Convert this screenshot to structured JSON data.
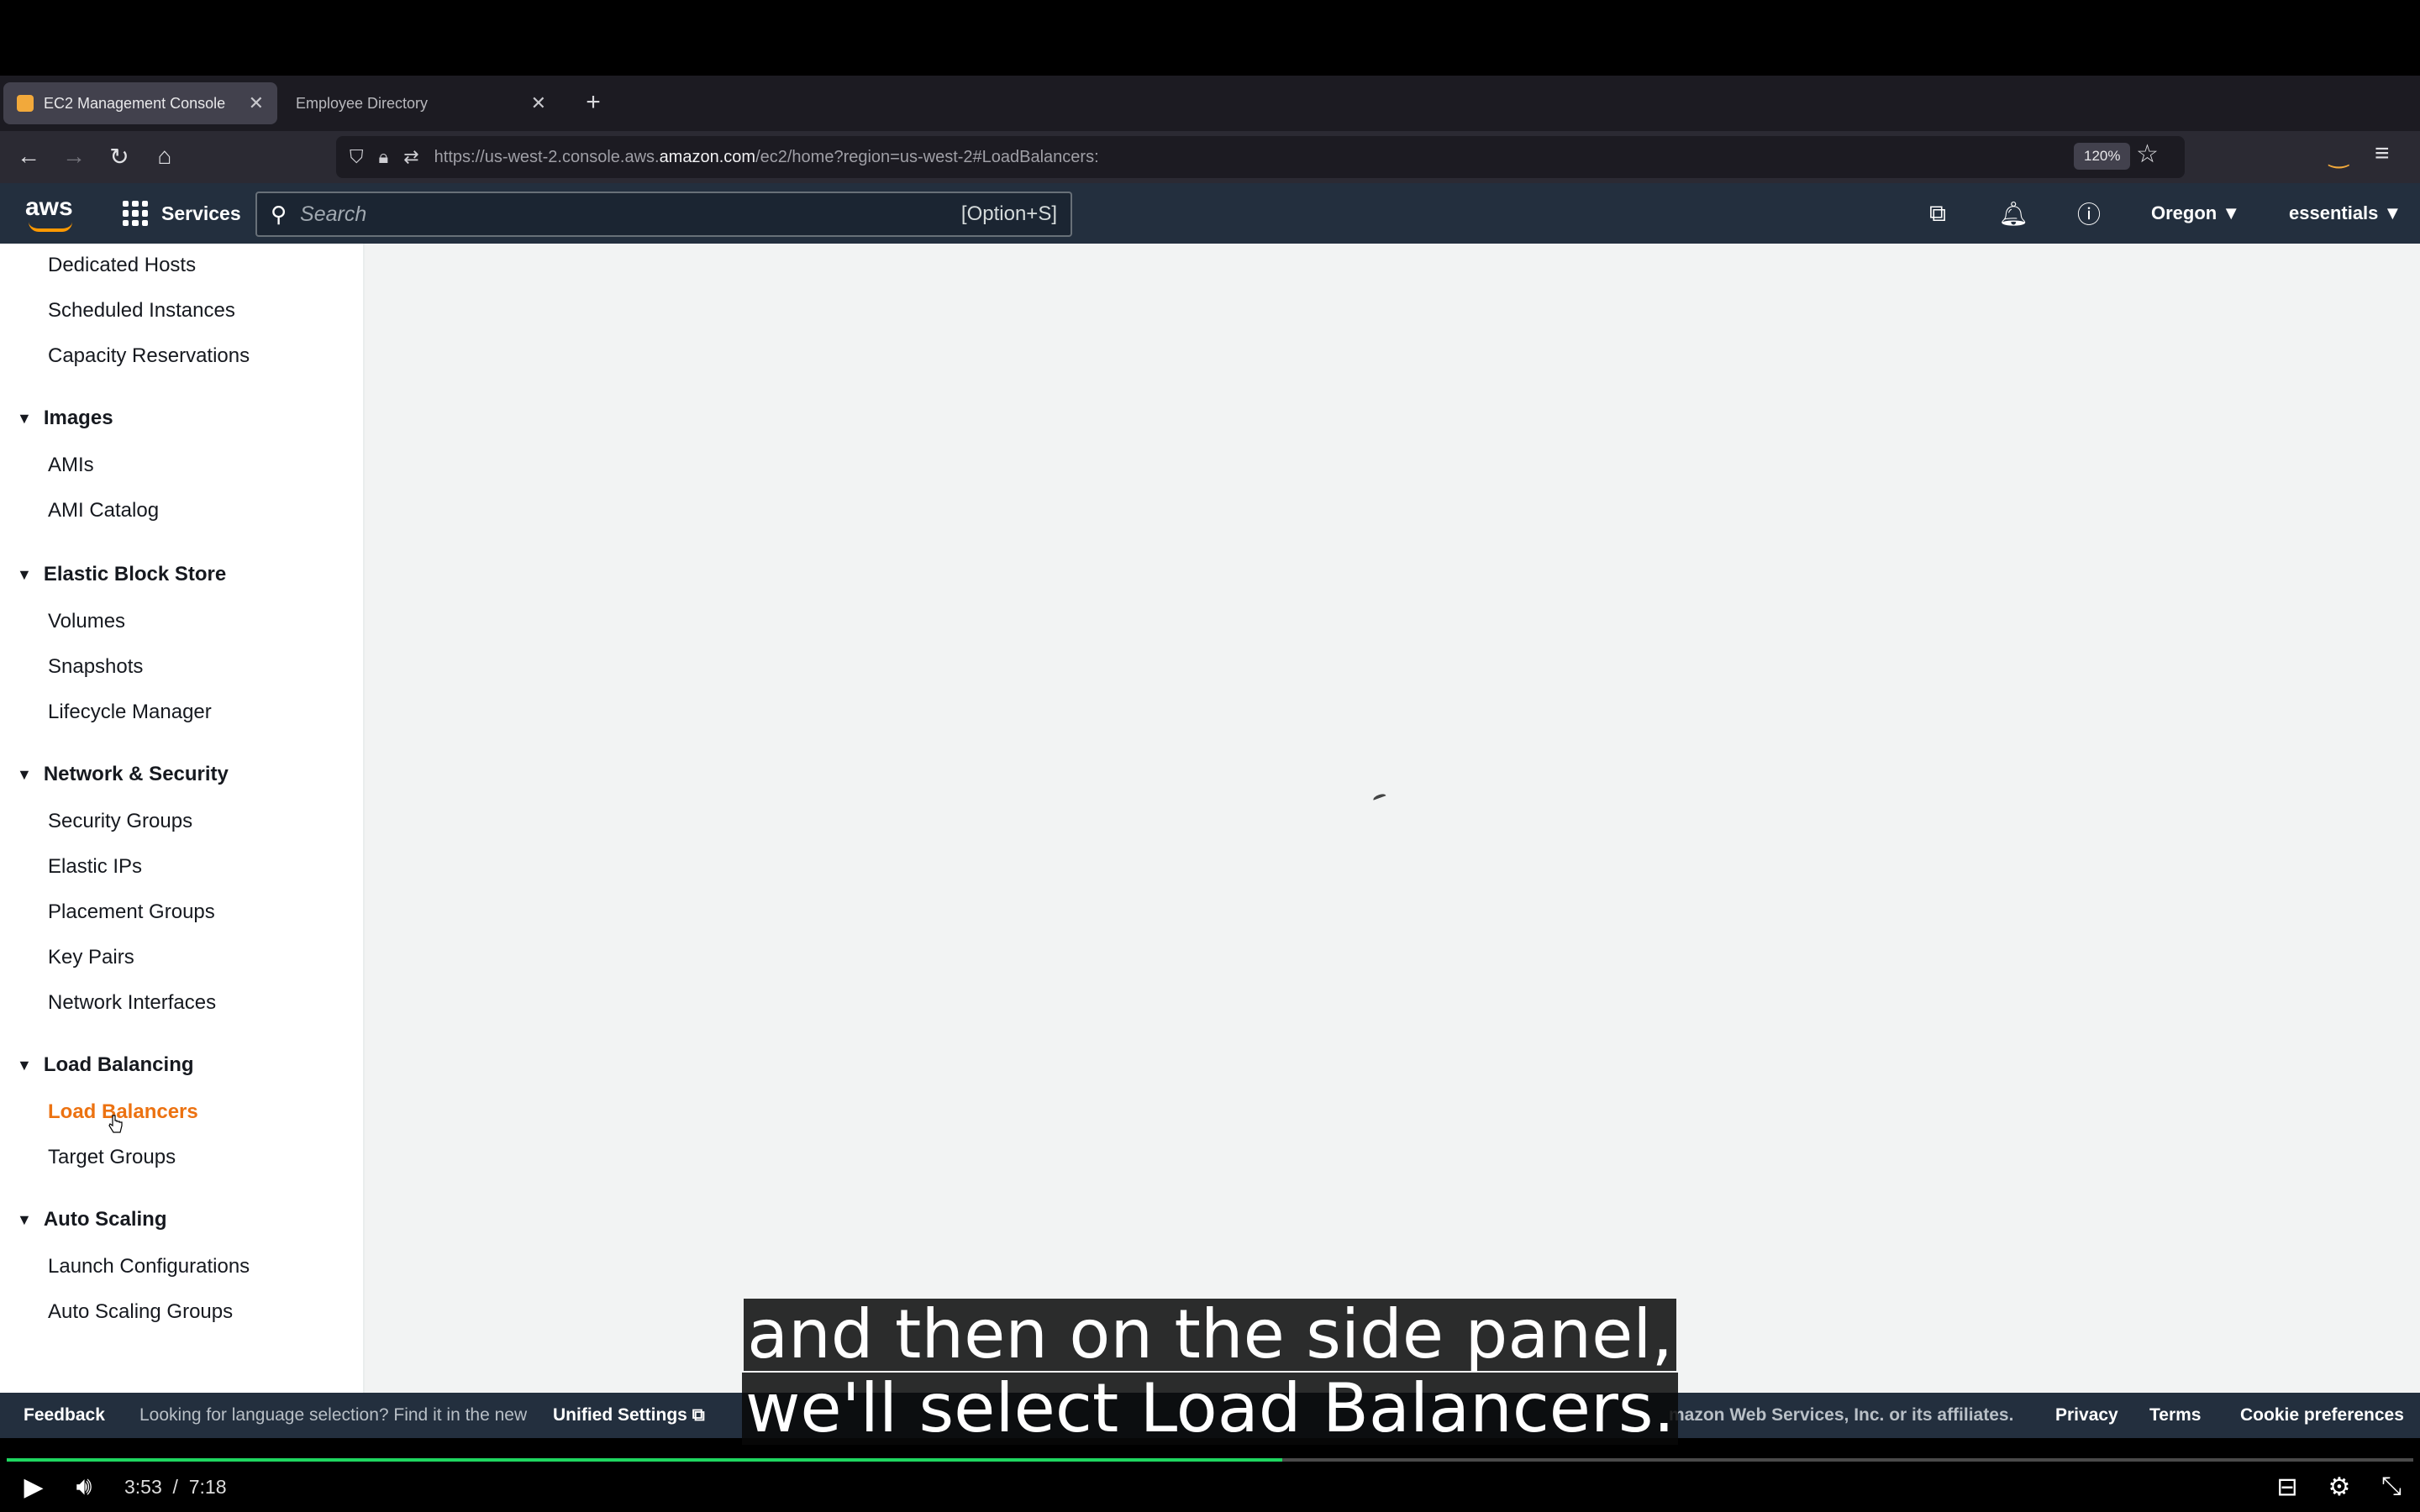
{
  "browser": {
    "tabs": [
      {
        "title": "EC2 Management Console",
        "active": true
      },
      {
        "title": "Employee Directory",
        "active": false
      }
    ],
    "url": {
      "prefix": "https://us-west-2.console.aws.",
      "domain": "amazon.com",
      "suffix": "/ec2/home?region=us-west-2#LoadBalancers:"
    },
    "zoom": "120%"
  },
  "aws_header": {
    "logo_text": "aws",
    "services_label": "Services",
    "search_placeholder": "Search",
    "search_shortcut": "[Option+S]",
    "region_label": "Oregon ▼",
    "account_label": "essentials ▼"
  },
  "sidebar": {
    "top_items": [
      "Dedicated Hosts",
      "Scheduled Instances",
      "Capacity Reservations"
    ],
    "sections": [
      {
        "title": "Images",
        "items": [
          "AMIs",
          "AMI Catalog"
        ]
      },
      {
        "title": "Elastic Block Store",
        "items": [
          "Volumes",
          "Snapshots",
          "Lifecycle Manager"
        ]
      },
      {
        "title": "Network & Security",
        "items": [
          "Security Groups",
          "Elastic IPs",
          "Placement Groups",
          "Key Pairs",
          "Network Interfaces"
        ]
      },
      {
        "title": "Load Balancing",
        "items": [
          "Load Balancers",
          "Target Groups"
        ]
      },
      {
        "title": "Auto Scaling",
        "items": [
          "Launch Configurations",
          "Auto Scaling Groups"
        ]
      }
    ],
    "active_item": "Load Balancers"
  },
  "footer": {
    "feedback": "Feedback",
    "language_notice": "Looking for language selection? Find it in the new",
    "unified_settings": "Unified Settings",
    "copyright": "mazon Web Services, Inc. or its affiliates.",
    "privacy": "Privacy",
    "terms": "Terms",
    "cookie_preferences": "Cookie preferences"
  },
  "captions": {
    "line1": "and then on the side panel,",
    "line2": "we'll select Load Balancers."
  },
  "player": {
    "current_time": "3:53",
    "separator": "/",
    "duration": "7:18",
    "progress_fraction": 0.53
  },
  "colors": {
    "aws_header_bg": "#232f3e",
    "active_link": "#ec7211",
    "progress": "#1ed760"
  }
}
